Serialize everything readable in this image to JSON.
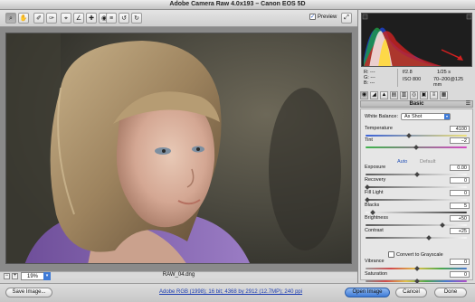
{
  "window": {
    "title": "Adobe Camera Raw 4.0x193  –  Canon EOS 5D"
  },
  "toolbar": {
    "tools": [
      {
        "name": "zoom-tool",
        "icon": "magnifier-icon",
        "glyph": "⌕"
      },
      {
        "name": "hand-tool",
        "icon": "hand-icon",
        "glyph": "✋"
      },
      {
        "name": "white-balance-tool",
        "icon": "eyedropper-icon",
        "glyph": "✐"
      },
      {
        "name": "color-sampler-tool",
        "icon": "color-sampler-icon",
        "glyph": "✑"
      },
      {
        "name": "crop-tool",
        "icon": "crop-icon",
        "glyph": "⌖"
      },
      {
        "name": "straighten-tool",
        "icon": "straighten-icon",
        "glyph": "∠"
      },
      {
        "name": "retouch-tool",
        "icon": "retouch-icon",
        "glyph": "✚"
      },
      {
        "name": "red-eye-tool",
        "icon": "red-eye-icon",
        "glyph": "◉"
      },
      {
        "name": "preferences-button",
        "icon": "preferences-icon",
        "glyph": "≡"
      },
      {
        "name": "rotate-ccw-button",
        "icon": "rotate-left-icon",
        "glyph": "↺"
      },
      {
        "name": "rotate-cw-button",
        "icon": "rotate-right-icon",
        "glyph": "↻"
      }
    ],
    "preview_label": "Preview",
    "preview_checked": true
  },
  "status": {
    "zoom": "19%",
    "filename": "RAW_04.dng"
  },
  "camera_info": {
    "r_label": "R:",
    "g_label": "G:",
    "b_label": "B:",
    "r_value": "---",
    "g_value": "---",
    "b_value": "---",
    "fstop": "f/2.8",
    "shutter": "1/25 s",
    "iso": "ISO 800",
    "lens": "70–200@125 mm"
  },
  "panel": {
    "title": "Basic",
    "menu_icon": "panel-menu-icon",
    "white_balance": {
      "label": "White Balance:",
      "value": "As Shot"
    },
    "auto_label": "Auto",
    "default_label": "Default",
    "grayscale_label": "Convert to Grayscale",
    "controls": [
      {
        "key": "temperature",
        "label": "Temperature",
        "value": "4100",
        "level": 0.42,
        "track": "temp"
      },
      {
        "key": "tint",
        "label": "Tint",
        "value": "−2",
        "level": 0.49,
        "track": "tint"
      },
      {
        "key": "exposure",
        "label": "Exposure",
        "value": "0.00",
        "level": 0.5,
        "track": "gray"
      },
      {
        "key": "recovery",
        "label": "Recovery",
        "value": "0",
        "level": 0.0,
        "track": "gray"
      },
      {
        "key": "fill-light",
        "label": "Fill Light",
        "value": "0",
        "level": 0.0,
        "track": "gray"
      },
      {
        "key": "blacks",
        "label": "Blacks",
        "value": "5",
        "level": 0.05,
        "track": "dark"
      },
      {
        "key": "brightness",
        "label": "Brightness",
        "value": "+50",
        "level": 0.75,
        "track": "gray"
      },
      {
        "key": "contrast",
        "label": "Contrast",
        "value": "+25",
        "level": 0.62,
        "track": "gray"
      },
      {
        "key": "vibrance",
        "label": "Vibrance",
        "value": "0",
        "level": 0.5,
        "track": "vib"
      },
      {
        "key": "saturation",
        "label": "Saturation",
        "value": "0",
        "level": 0.5,
        "track": "sat"
      }
    ]
  },
  "bottom": {
    "save_label": "Save Image...",
    "workflow_link": "Adobe RGB (1998); 16 bit; 4368 by 2912 (12.7MP); 240 ppi",
    "open_label": "Open Image",
    "cancel_label": "Cancel",
    "done_label": "Done"
  },
  "colors": {
    "accent": "#3e7ad6",
    "annotation_arrow": "#d42020"
  }
}
